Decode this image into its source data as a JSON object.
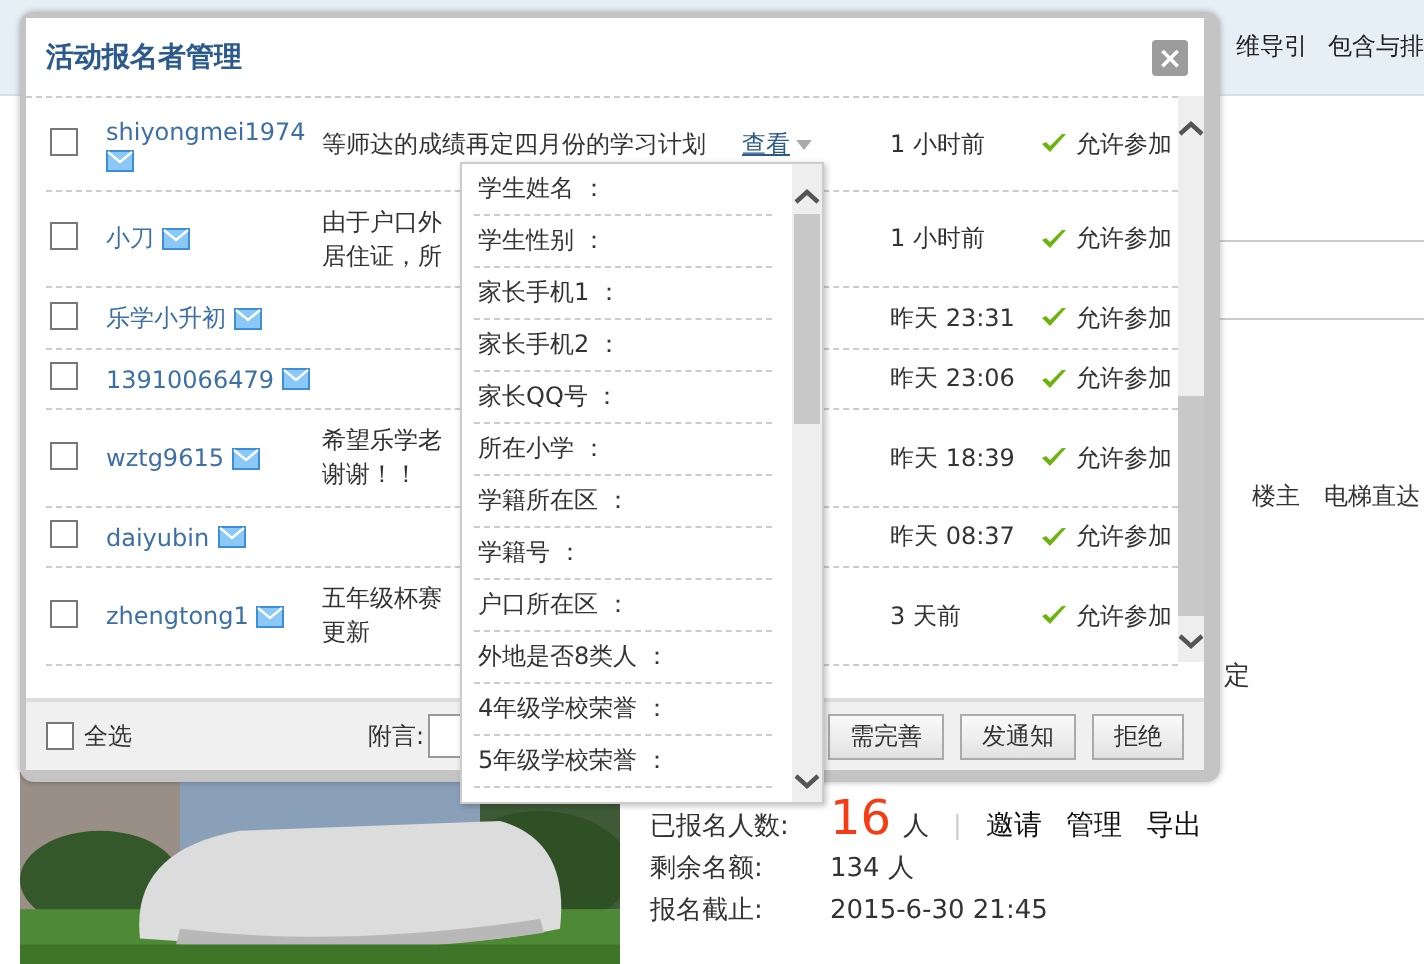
{
  "background": {
    "top_links": [
      "维导引",
      "包含与排"
    ],
    "thread_links": [
      "楼主",
      "电梯直达"
    ],
    "side_fragment": "定",
    "stats": [
      {
        "label": "已报名人数:",
        "count": "16",
        "unit": "人",
        "separator": "|",
        "actions": [
          "邀请",
          "管理",
          "导出"
        ]
      },
      {
        "label": "剩余名额:",
        "value": "134 人"
      },
      {
        "label": "报名截止:",
        "value": "2015-6-30 21:45"
      }
    ]
  },
  "dialog": {
    "title": "活动报名者管理",
    "close": "×",
    "rows": [
      {
        "name": "shiyongmei1974",
        "checked": false,
        "message": [
          "等师达的成绩再定四月份的学习计划"
        ],
        "action": "查看",
        "expanded": true,
        "time": "1 小时前",
        "status": "允许参加"
      },
      {
        "name": "小刀",
        "checked": false,
        "message": [
          "由于户口外",
          "居住证，所"
        ],
        "time": "1 小时前",
        "status": "允许参加"
      },
      {
        "name": "乐学小升初",
        "checked": false,
        "message": [],
        "time": "昨天 23:31",
        "status": "允许参加"
      },
      {
        "name": "13910066479",
        "checked": false,
        "message": [],
        "time": "昨天 23:06",
        "status": "允许参加"
      },
      {
        "name": "wztg9615",
        "checked": false,
        "message": [
          "希望乐学老",
          "谢谢！！"
        ],
        "time": "昨天 18:39",
        "status": "允许参加"
      },
      {
        "name": "daiyubin",
        "checked": false,
        "message": [],
        "time": "昨天 08:37",
        "status": "允许参加"
      },
      {
        "name": "zhengtong1",
        "checked": false,
        "message": [
          "五年级杯赛",
          "更新"
        ],
        "time": "3 天前",
        "status": "允许参加"
      }
    ],
    "footer": {
      "select_all": "全选",
      "checked": false,
      "note_label": "附言:",
      "buttons": [
        "需完善",
        "发通知",
        "拒绝"
      ]
    }
  },
  "popup": {
    "fields": [
      "学生姓名 ：",
      "学生性别 ：",
      "家长手机1 ：",
      "家长手机2 ：",
      "家长QQ号 ：",
      "所在小学 ：",
      "学籍所在区 ：",
      "学籍号 ：",
      "户口所在区 ：",
      "外地是否8类人 ：",
      "4年级学校荣誉 ：",
      "5年级学校荣誉 ："
    ]
  }
}
